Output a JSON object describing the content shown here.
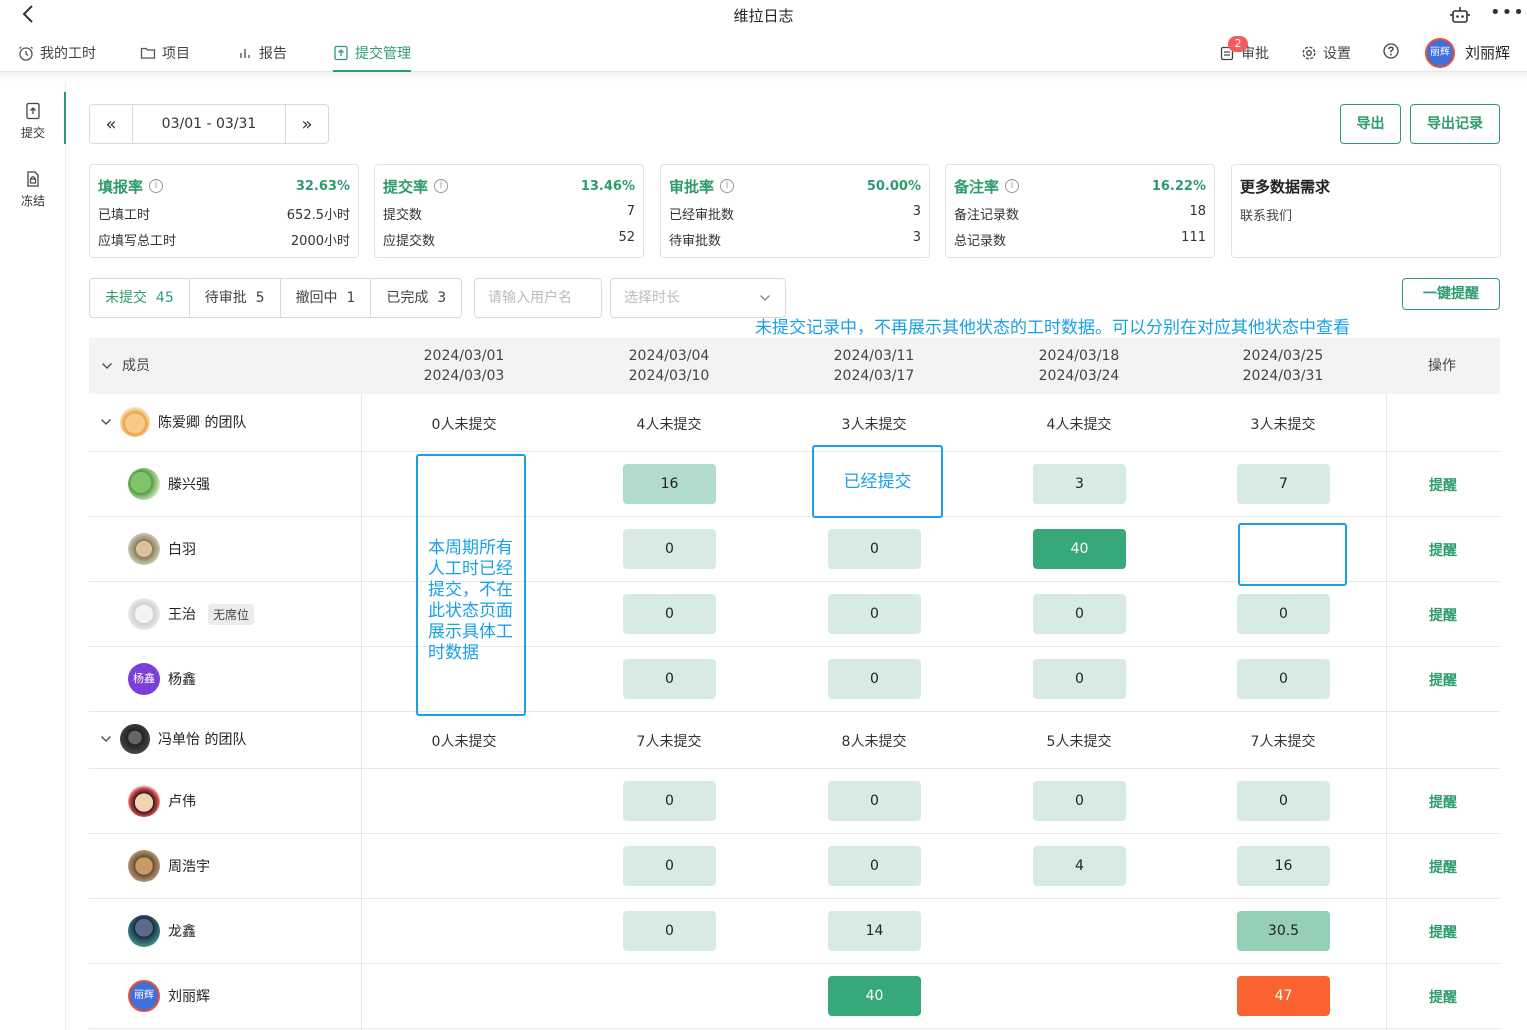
{
  "app": {
    "title": "维拉日志"
  },
  "nav": {
    "items": [
      {
        "label": "我的工时",
        "icon": "clock-icon"
      },
      {
        "label": "项目",
        "icon": "folder-icon"
      },
      {
        "label": "报告",
        "icon": "bar-chart-icon"
      },
      {
        "label": "提交管理",
        "icon": "upload-doc-icon"
      }
    ],
    "active": "提交管理",
    "approval_label": "审批",
    "approval_badge": "2",
    "settings_label": "设置",
    "user_name": "刘丽辉",
    "user_avatar_text": "丽辉"
  },
  "sidebar": {
    "items": [
      {
        "label": "提交"
      },
      {
        "label": "冻结"
      }
    ],
    "active": "提交"
  },
  "toolbar": {
    "prev": "«",
    "date_range": "03/01 - 03/31",
    "next": "»",
    "export_label": "导出",
    "export_records_label": "导出记录"
  },
  "stats": [
    {
      "name": "填报率",
      "pct": "32.63%",
      "rows": [
        [
          "已填工时",
          "652.5小时"
        ],
        [
          "应填写总工时",
          "2000小时"
        ]
      ]
    },
    {
      "name": "提交率",
      "pct": "13.46%",
      "rows": [
        [
          "提交数",
          "7"
        ],
        [
          "应提交数",
          "52"
        ]
      ]
    },
    {
      "name": "审批率",
      "pct": "50.00%",
      "rows": [
        [
          "已经审批数",
          "3"
        ],
        [
          "待审批数",
          "3"
        ]
      ]
    },
    {
      "name": "备注率",
      "pct": "16.22%",
      "rows": [
        [
          "备注记录数",
          "18"
        ],
        [
          "总记录数",
          "111"
        ]
      ]
    }
  ],
  "more_data": {
    "title": "更多数据需求",
    "contact": "联系我们"
  },
  "filters": {
    "tabs": [
      {
        "label": "未提交",
        "count": "45"
      },
      {
        "label": "待审批",
        "count": "5"
      },
      {
        "label": "撤回中",
        "count": "1"
      },
      {
        "label": "已完成",
        "count": "3"
      }
    ],
    "user_placeholder": "请输入用户名",
    "duration_placeholder": "选择时长",
    "remind_all_label": "一键提醒"
  },
  "annotation_top": "未提交记录中，不再展示其他状态的工时数据。可以分别在对应其他状态中查看",
  "annotation_col1": [
    "本周期所有",
    "人工时已经",
    "提交，不在",
    "此状态页面",
    "展示具体工",
    "时数据"
  ],
  "annotation_cell": "已经提交",
  "table": {
    "member_header": "成员",
    "action_header": "操作",
    "periods": [
      [
        "2024/03/01",
        "2024/03/03"
      ],
      [
        "2024/03/04",
        "2024/03/10"
      ],
      [
        "2024/03/11",
        "2024/03/17"
      ],
      [
        "2024/03/18",
        "2024/03/24"
      ],
      [
        "2024/03/25",
        "2024/03/31"
      ]
    ],
    "remind_label": "提醒",
    "teams": [
      {
        "name": "陈爱卿 的团队",
        "counts": [
          "0人未提交",
          "4人未提交",
          "3人未提交",
          "4人未提交",
          "3人未提交"
        ],
        "members": [
          {
            "name": "滕兴强",
            "tag": "",
            "values": [
              "",
              "16",
              "",
              "3",
              "7"
            ]
          },
          {
            "name": "白羽",
            "tag": "",
            "values": [
              "",
              "0",
              "0",
              "40",
              ""
            ]
          },
          {
            "name": "王治",
            "tag": "无席位",
            "values": [
              "",
              "0",
              "0",
              "0",
              "0"
            ]
          },
          {
            "name": "杨鑫",
            "tag": "",
            "avatar_text": "杨鑫",
            "values": [
              "",
              "0",
              "0",
              "0",
              "0"
            ]
          }
        ]
      },
      {
        "name": "冯单怡 的团队",
        "counts": [
          "0人未提交",
          "7人未提交",
          "8人未提交",
          "5人未提交",
          "7人未提交"
        ],
        "members": [
          {
            "name": "卢伟",
            "tag": "",
            "values": [
              "",
              "0",
              "0",
              "0",
              "0"
            ]
          },
          {
            "name": "周浩宇",
            "tag": "",
            "values": [
              "",
              "0",
              "0",
              "4",
              "16"
            ]
          },
          {
            "name": "龙鑫",
            "tag": "",
            "values": [
              "",
              "0",
              "14",
              "",
              "30.5"
            ]
          },
          {
            "name": "刘丽辉",
            "tag": "",
            "avatar_text": "丽辉",
            "values": [
              "",
              "",
              "40",
              "",
              "47"
            ]
          }
        ]
      }
    ]
  },
  "colors": {
    "accent": "#2e9b6e",
    "annotation": "#1aa0e6",
    "cell_light": "#d7ebe3",
    "cell_mid": "#b1dbcb",
    "cell_dark": "#37a879",
    "cell_warning": "#fa6230"
  }
}
